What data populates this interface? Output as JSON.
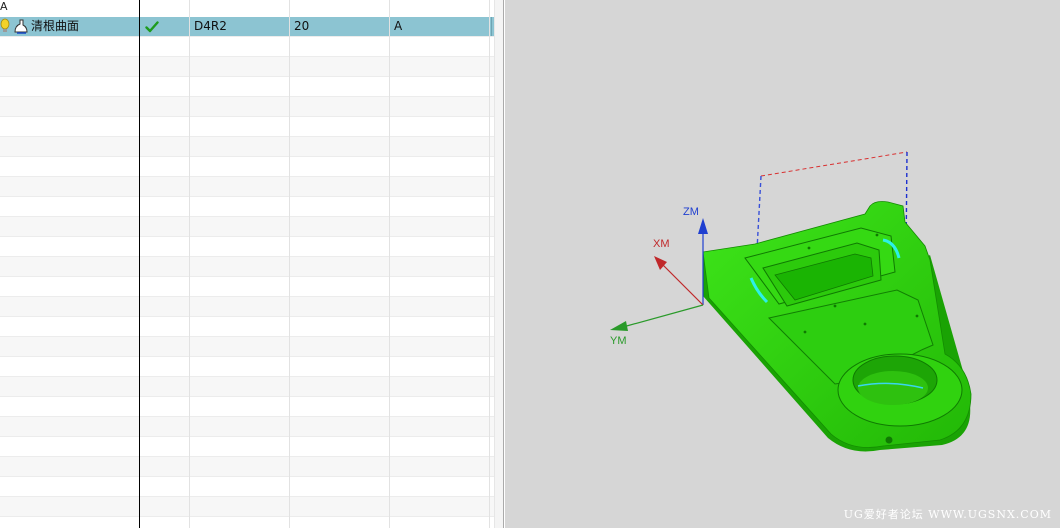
{
  "navigator": {
    "header_text": "A",
    "selected_row": {
      "name": "清根曲面",
      "status_icon": "check-icon",
      "tool": "D4R2",
      "column_4": "20",
      "column_5": "A"
    },
    "empty_rows": 24
  },
  "viewport": {
    "background": "#d6d6d6",
    "part_color": "#2fd40b",
    "axes": {
      "z_label": "ZM",
      "x_label": "XM",
      "y_label": "YM",
      "z_color": "#1f3fd0",
      "x_color": "#c0282a",
      "y_color": "#2a9a2a"
    },
    "watermark": "UG爱好者论坛 WWW.UGSNX.COM"
  }
}
